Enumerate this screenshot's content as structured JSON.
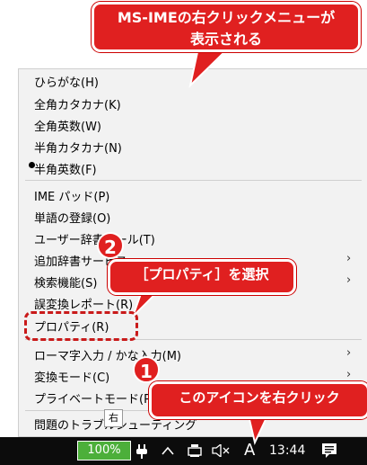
{
  "callouts": {
    "top_line1": "MS-IMEの右クリックメニューが",
    "top_line2": "表示される",
    "select_properties": "［プロパティ］を選択",
    "click_icon": "このアイコンを右クリック",
    "step1": "1",
    "step2": "2"
  },
  "menu": {
    "items": [
      {
        "label": "ひらがな(H)"
      },
      {
        "label": "全角カタカナ(K)"
      },
      {
        "label": "全角英数(W)"
      },
      {
        "label": "半角カタカナ(N)"
      },
      {
        "label": "半角英数(F)",
        "checked": true
      },
      {
        "label": "IME パッド(P)"
      },
      {
        "label": "単語の登録(O)"
      },
      {
        "label": "ユーザー辞書ツール(T)"
      },
      {
        "label": "追加辞書サービス",
        "submenu": true
      },
      {
        "label": "検索機能(S)",
        "submenu": true
      },
      {
        "label": "誤変換レポート(R)"
      },
      {
        "label": "プロパティ(R)"
      },
      {
        "label": "ローマ字入力 / かな入力(M)",
        "submenu": true
      },
      {
        "label": "変換モード(C)",
        "submenu": true
      },
      {
        "label": "プライベートモード(P)"
      },
      {
        "label": "問題のトラブルシューティング"
      }
    ],
    "submenu_glyph": "›"
  },
  "tooltip": "右",
  "taskbar": {
    "battery": "100%",
    "ime_indicator": "A",
    "time": "13:44",
    "icons": [
      "plug-icon",
      "chevron-up-icon",
      "network-icon",
      "speaker-muted-icon",
      "notification-icon"
    ]
  },
  "colors": {
    "callout": "#e02020",
    "battery": "#4caf3a",
    "taskbar": "#0c0c0c"
  }
}
